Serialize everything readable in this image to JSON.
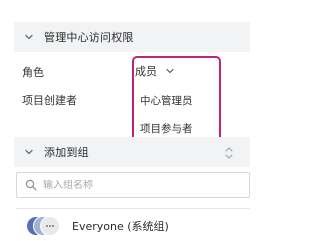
{
  "access_section": {
    "title": "管理中心访问权限",
    "role_label": "角色",
    "role_value": "成员",
    "creator_label": "项目创建者",
    "dropdown_options": [
      "中心管理员",
      "项目参与者"
    ]
  },
  "group_section": {
    "title": "添加到组",
    "search_placeholder": "输入组名称",
    "groups": [
      {
        "name": "Everyone (系统组)"
      }
    ]
  },
  "colors": {
    "header_bg": "#f2f3f5",
    "dropdown_border": "#c0247a",
    "avatar_primary": "#5b6fae",
    "avatar_secondary": "#9fb3d6"
  },
  "icons": {
    "section_toggle": "chevron-down-icon",
    "select_toggle": "chevron-down-icon",
    "search": "search-icon",
    "more": "ellipsis-icon",
    "scroll": "scroll-arrows-icon"
  }
}
